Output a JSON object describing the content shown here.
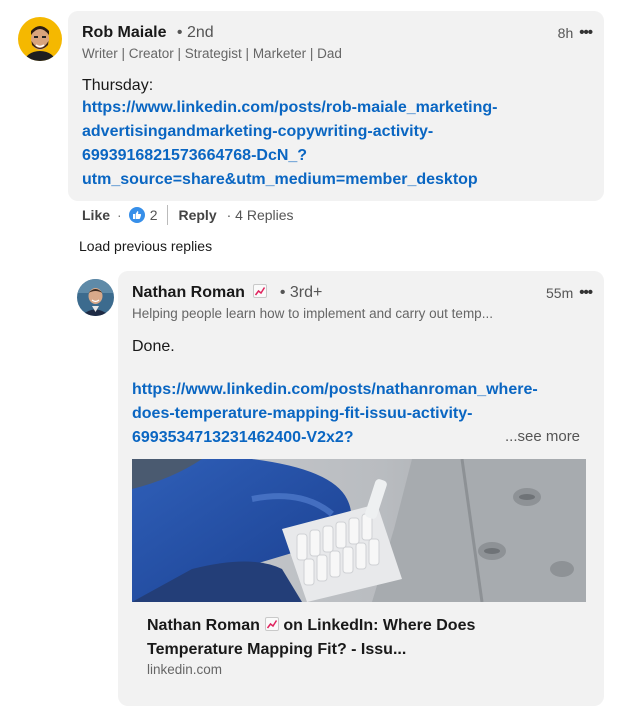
{
  "comment": {
    "author": "Rob Maiale",
    "degree": "• 2nd",
    "headline": "Writer | Creator | Strategist | Marketer | Dad",
    "time": "8h",
    "more": "•••",
    "text": "Thursday:",
    "link_lines": [
      "https://www.linkedin.com/posts/rob-maiale_marketing-",
      "advertisingandmarketing-copywriting-activity-",
      "6993916821573664768-DcN_?",
      "utm_source=share&utm_medium=member_desktop"
    ],
    "actions": {
      "like": "Like",
      "dot": "·",
      "reaction_count": "2",
      "reply": "Reply",
      "replies": "· 4 Replies"
    }
  },
  "load_previous": "Load previous replies",
  "reply": {
    "author": "Nathan Roman",
    "degree": "• 3rd+",
    "headline": "Helping people learn how to implement and carry out temp...",
    "time": "55m",
    "more": "•••",
    "text": "Done.",
    "link_lines": [
      "https://www.linkedin.com/posts/nathanroman_where-",
      "does-temperature-mapping-fit-issuu-activity-",
      "6993534713231462400-V2x2?"
    ],
    "see_more": "...see more",
    "preview": {
      "title_line1": "Nathan Roman",
      "title_line1_rest": " on LinkedIn: Where Does",
      "title_line2": "Temperature Mapping Fit? - Issu...",
      "domain": "linkedin.com"
    }
  },
  "colors": {
    "link": "#0a66c2",
    "bubble": "#f2f2f2",
    "like_blue": "#378fe9"
  },
  "icons": {
    "trend": "trending-chart-emoji-icon",
    "like": "thumbs-up-reaction-icon",
    "more": "more-options-icon"
  }
}
